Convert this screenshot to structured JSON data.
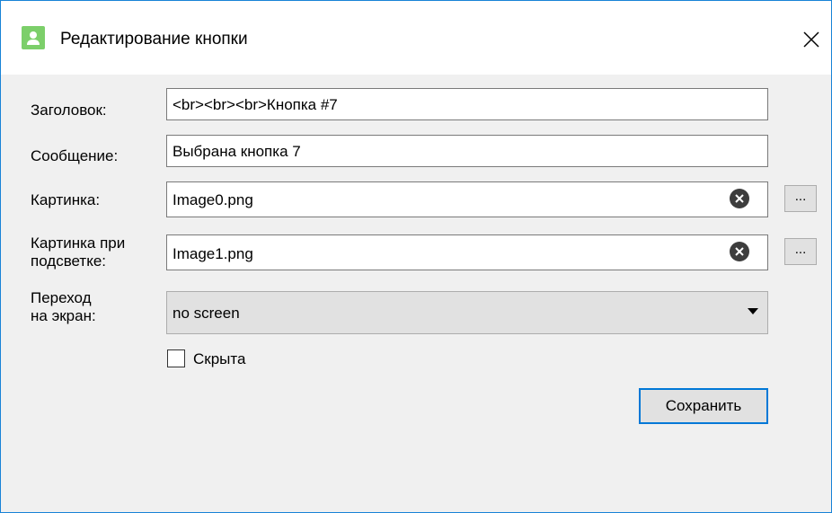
{
  "window": {
    "title": "Редактирование кнопки",
    "icon": "user-icon",
    "close": "close-icon"
  },
  "form": {
    "header_label": "Заголовок:",
    "header_value": "<br><br><br>Кнопка #7",
    "message_label": "Сообщение:",
    "message_value": "Выбрана кнопка 7",
    "image_label": "Картинка:",
    "image_value": "Image0.png",
    "hover_image_label_line1": "Картинка при",
    "hover_image_label_line2": "подсветке:",
    "hover_image_value": "Image1.png",
    "browse_label": "...",
    "screen_label_line1": "Переход",
    "screen_label_line2": "на экран:",
    "screen_value": "no screen",
    "hidden_label": "Скрыта",
    "hidden_checked": false,
    "save_label": "Сохранить"
  },
  "colors": {
    "accent": "#0078d7",
    "window_border": "#1883d7",
    "icon_bg": "#7ccf6a",
    "dialog_bg": "#f0f0f0"
  }
}
